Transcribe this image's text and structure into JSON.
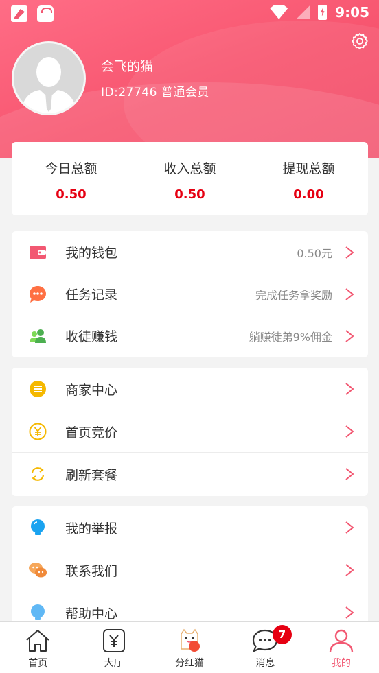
{
  "status_bar": {
    "time": "9:05"
  },
  "profile": {
    "username": "会飞的猫",
    "id_line": "ID:27746 普通会员"
  },
  "stats": [
    {
      "label": "今日总额",
      "value": "0.50"
    },
    {
      "label": "收入总额",
      "value": "0.50"
    },
    {
      "label": "提现总额",
      "value": "0.00"
    }
  ],
  "menu_group1": [
    {
      "label": "我的钱包",
      "right": "0.50元",
      "icon": "wallet-icon"
    },
    {
      "label": "任务记录",
      "right": "完成任务拿奖励",
      "icon": "chat-bubble-icon"
    },
    {
      "label": "收徒赚钱",
      "right": "躺赚徒弟9%佣金",
      "icon": "users-icon"
    }
  ],
  "menu_group2": [
    {
      "label": "商家中心",
      "icon": "list-circle-icon"
    },
    {
      "label": "首页竞价",
      "icon": "yen-coin-icon"
    },
    {
      "label": "刷新套餐",
      "icon": "refresh-icon"
    }
  ],
  "menu_group3": [
    {
      "label": "我的举报",
      "icon": "lightbulb-icon"
    },
    {
      "label": "联系我们",
      "icon": "wechat-icon"
    },
    {
      "label": "帮助中心",
      "icon": "help-bulb-icon"
    }
  ],
  "tabbar": [
    {
      "label": "首页",
      "icon": "home-icon"
    },
    {
      "label": "大厅",
      "icon": "yen-box-icon"
    },
    {
      "label": "分红猫",
      "icon": "lucky-cat-icon"
    },
    {
      "label": "消息",
      "icon": "message-icon",
      "badge": "7"
    },
    {
      "label": "我的",
      "icon": "person-icon",
      "active": true
    }
  ],
  "colors": {
    "accent": "#f25872",
    "amount": "#e60012",
    "yellow": "#f5b800",
    "blue": "#1aa3f0"
  }
}
